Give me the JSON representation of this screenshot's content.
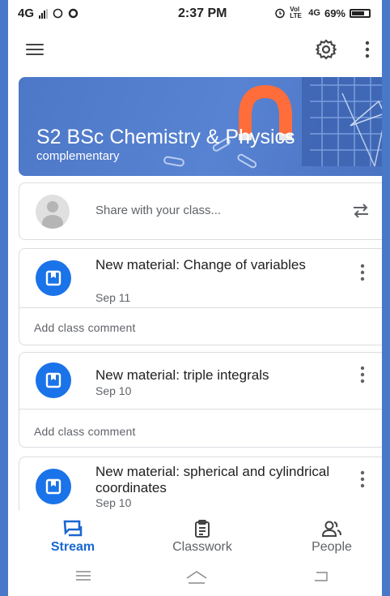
{
  "status_bar": {
    "network": "4G",
    "time": "2:37 PM",
    "volte": "Vol LTE",
    "net2": "4G",
    "battery": "69%"
  },
  "app_bar": {
    "menu_icon": "menu-icon",
    "settings_icon": "gear-icon",
    "more_icon": "more-vert-icon"
  },
  "class": {
    "title": "S2 BSc Chemistry & Physics",
    "subtitle": "complementary"
  },
  "share": {
    "placeholder": "Share with your class..."
  },
  "posts": [
    {
      "title": "New material: Change of variables",
      "date": "Sep 11",
      "comment": "Add class comment"
    },
    {
      "title": "New material: triple integrals",
      "date": "Sep 10",
      "comment": "Add class comment"
    },
    {
      "title": "New material: spherical and cylindrical coordinates",
      "date": "Sep 10"
    }
  ],
  "bottom_nav": [
    {
      "label": "Stream",
      "active": true
    },
    {
      "label": "Classwork",
      "active": false
    },
    {
      "label": "People",
      "active": false
    }
  ],
  "colors": {
    "accent": "#1967d2",
    "banner": "#4d77c7",
    "frame": "#4a78c9"
  }
}
